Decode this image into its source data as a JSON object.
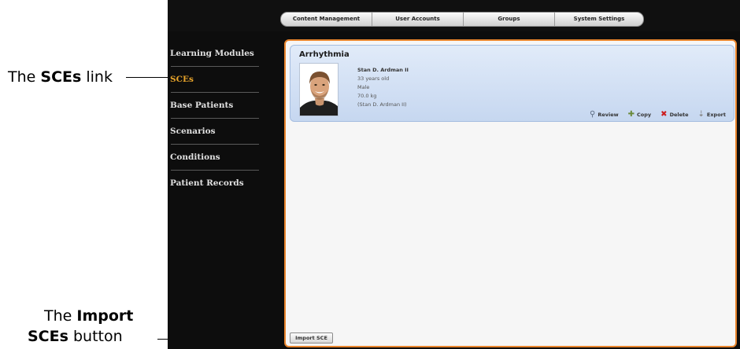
{
  "callouts": {
    "sces_link": {
      "prefix": "The ",
      "bold": "SCEs",
      "suffix": " link"
    },
    "import_button": {
      "line1_prefix": "The ",
      "line1_bold": "Import",
      "line2_bold": "SCEs",
      "line2_suffix": " button"
    }
  },
  "nav": {
    "tabs": [
      "Content Management",
      "User Accounts",
      "Groups",
      "System Settings"
    ]
  },
  "sidebar": {
    "items": [
      {
        "label": "Learning Modules",
        "active": false
      },
      {
        "label": "SCEs",
        "active": true
      },
      {
        "label": "Base Patients",
        "active": false
      },
      {
        "label": "Scenarios",
        "active": false
      },
      {
        "label": "Conditions",
        "active": false
      },
      {
        "label": "Patient Records",
        "active": false
      }
    ]
  },
  "sce": {
    "title": "Arrhythmia",
    "patient_name": "Stan D. Ardman II",
    "age": "33 years old",
    "sex": "Male",
    "weight": "70.0 kg",
    "base_patient": "(Stan D. Ardman II)"
  },
  "actions": {
    "review": "Review",
    "copy": "Copy",
    "delete": "Delete",
    "export": "Export"
  },
  "footer": {
    "import_label": "Import SCE"
  },
  "colors": {
    "accent_orange": "#e9852d",
    "active_link": "#e8a42a",
    "card_blue": "#c6d7f0"
  }
}
